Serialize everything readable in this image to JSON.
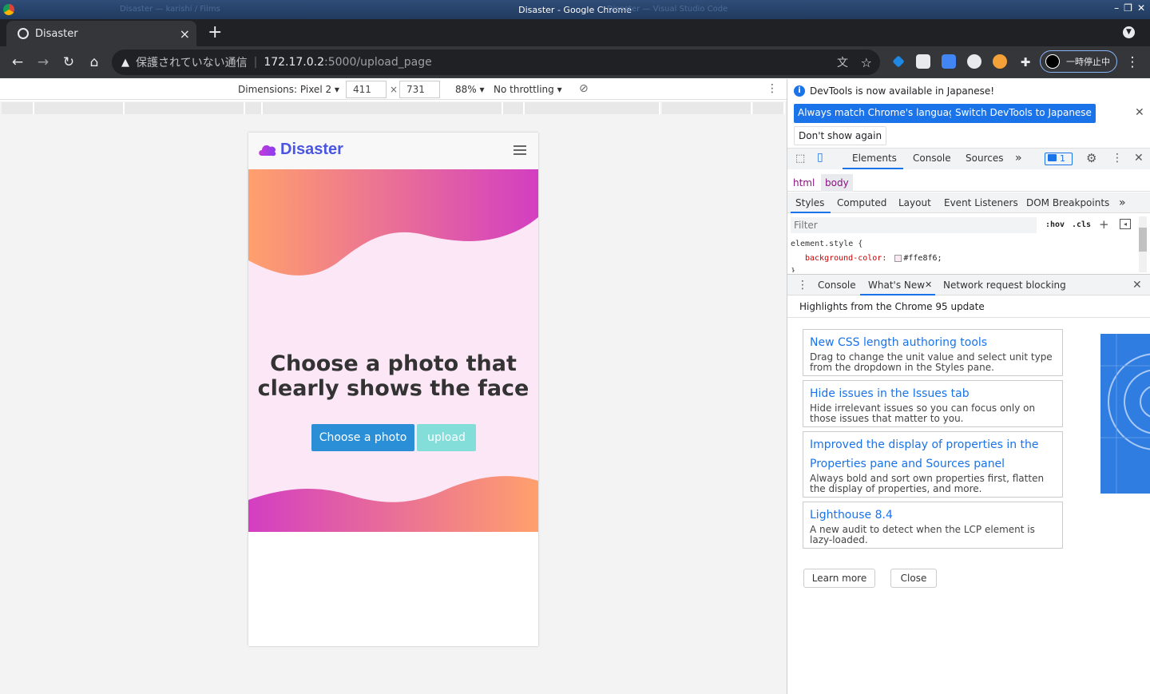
{
  "window": {
    "title": "Disaster - Google Chrome",
    "ghost_left": "Disaster — karishi / Films",
    "ghost_right": "Disaster — Visual Studio Code"
  },
  "tab": {
    "title": "Disaster",
    "close": "×",
    "new_tab": "+"
  },
  "omnibox": {
    "security_text": "保護されていない通信",
    "url_host": "172.17.0.2",
    "url_path": ":5000/upload_page"
  },
  "profile": {
    "label": "一時停止中"
  },
  "emulation": {
    "device": "Dimensions: Pixel 2",
    "width": "411",
    "height": "731",
    "times": "×",
    "zoom": "88%",
    "throttling": "No throttling"
  },
  "page": {
    "brand": "Disaster",
    "headline_line1": "Choose a photo that",
    "headline_line2": "clearly shows the face",
    "choose_button": "Choose a photo",
    "upload_button": "upload",
    "colors": {
      "hero_bg": "#fce7f6",
      "gradient_start": "#ff9f6e",
      "gradient_end": "#d43fc2",
      "choose_btn": "#2a8fd6",
      "upload_btn": "#83ddd9",
      "brand": "#4a56e2"
    }
  },
  "devtools": {
    "infobar_text": "DevTools is now available in Japanese!",
    "match_language_button": "Always match Chrome's language",
    "switch_japanese_button": "Switch DevTools to Japanese",
    "dont_show_button": "Don't show again",
    "main_tabs": [
      "Elements",
      "Console",
      "Sources"
    ],
    "more_tabs": "»",
    "issues_count": "1",
    "breadcrumbs": [
      "html",
      "body"
    ],
    "styles_tabs": [
      "Styles",
      "Computed",
      "Layout",
      "Event Listeners",
      "DOM Breakpoints"
    ],
    "filter_placeholder": "Filter",
    "hov": ":hov",
    "cls": ".cls",
    "rule_selector": "element.style {",
    "rule_property": "background-color:",
    "rule_value": "#ffe8f6;",
    "rule_close": "}",
    "drawer_tabs": [
      "Console",
      "What's New",
      "Network request blocking"
    ],
    "highlights_title": "Highlights from the Chrome 95 update",
    "cards": [
      {
        "title": "New CSS length authoring tools",
        "desc": "Drag to change the unit value and select unit type from the dropdown in the Styles pane."
      },
      {
        "title": "Hide issues in the Issues tab",
        "desc": "Hide irrelevant issues so you can focus only on those issues that matter to you."
      },
      {
        "title": "Improved the display of properties in the Properties pane and Sources panel",
        "desc": "Always bold and sort own properties first, flatten the display of properties, and more."
      },
      {
        "title": "Lighthouse 8.4",
        "desc": "A new audit to detect when the LCP element is lazy-loaded."
      }
    ],
    "learn_more_button": "Learn more",
    "close_button": "Close"
  }
}
